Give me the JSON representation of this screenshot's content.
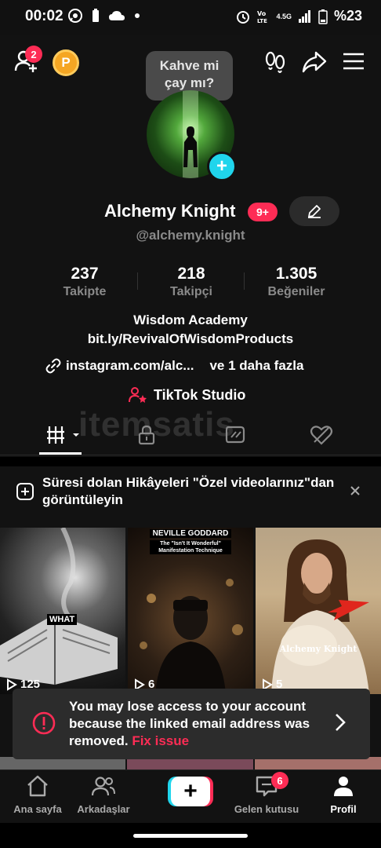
{
  "status": {
    "time": "00:02",
    "battery": "%23",
    "icons": [
      "whatsapp-icon",
      "battery-saver-icon",
      "cloud-icon",
      "dot-icon",
      "alarm-icon",
      "volte-icon",
      "signal-icon",
      "battery-icon"
    ],
    "network": "4.5G"
  },
  "header": {
    "add_friend_badge": "2",
    "p_badge": "P",
    "bubble_line1": "Kahve mi",
    "bubble_line2": "çay mı?"
  },
  "profile": {
    "display_name": "Alchemy Knight",
    "name_badge": "9+",
    "username": "@alchemy.knight",
    "stats": [
      {
        "value": "237",
        "label": "Takipte"
      },
      {
        "value": "218",
        "label": "Takipçi"
      },
      {
        "value": "1.305",
        "label": "Beğeniler"
      }
    ],
    "bio_line1": "Wisdom Academy",
    "bio_line2": "bit.ly/RevivalOfWisdomProducts",
    "link_text": "instagram.com/alc...",
    "link_more": "ve 1 daha fazla",
    "studio_label": "TikTok Studio",
    "watermark": "itemsatis"
  },
  "tabs": [
    "videos-grid-tab",
    "private-tab",
    "reposts-tab",
    "liked-tab"
  ],
  "story_banner": {
    "text": "Süresi dolan Hikâyeleri \"Özel videolarınız\"dan görüntüleyin"
  },
  "videos": [
    {
      "views": "125",
      "caption": "WHAT",
      "palette": "#2a2a2a"
    },
    {
      "views": "6",
      "caption_title": "NEVILLE GODDARD",
      "caption_sub": "The \"Isn't It Wonderful\" Manifestation Technique",
      "palette": "#3b2a1c"
    },
    {
      "views": "5",
      "caption": "Alchemy Knight",
      "palette": "#c9a97a"
    }
  ],
  "toast": {
    "message": "You may lose access to your account because the linked email address was removed.",
    "link": "Fix issue"
  },
  "nav": {
    "home": "Ana sayfa",
    "friends": "Arkadaşlar",
    "inbox": "Gelen kutusu",
    "inbox_badge": "6",
    "profile": "Profil"
  },
  "colors": {
    "accent": "#fe2c55",
    "cyan": "#20d5ec",
    "background": "#121212",
    "toast": "#2c2c2c"
  }
}
